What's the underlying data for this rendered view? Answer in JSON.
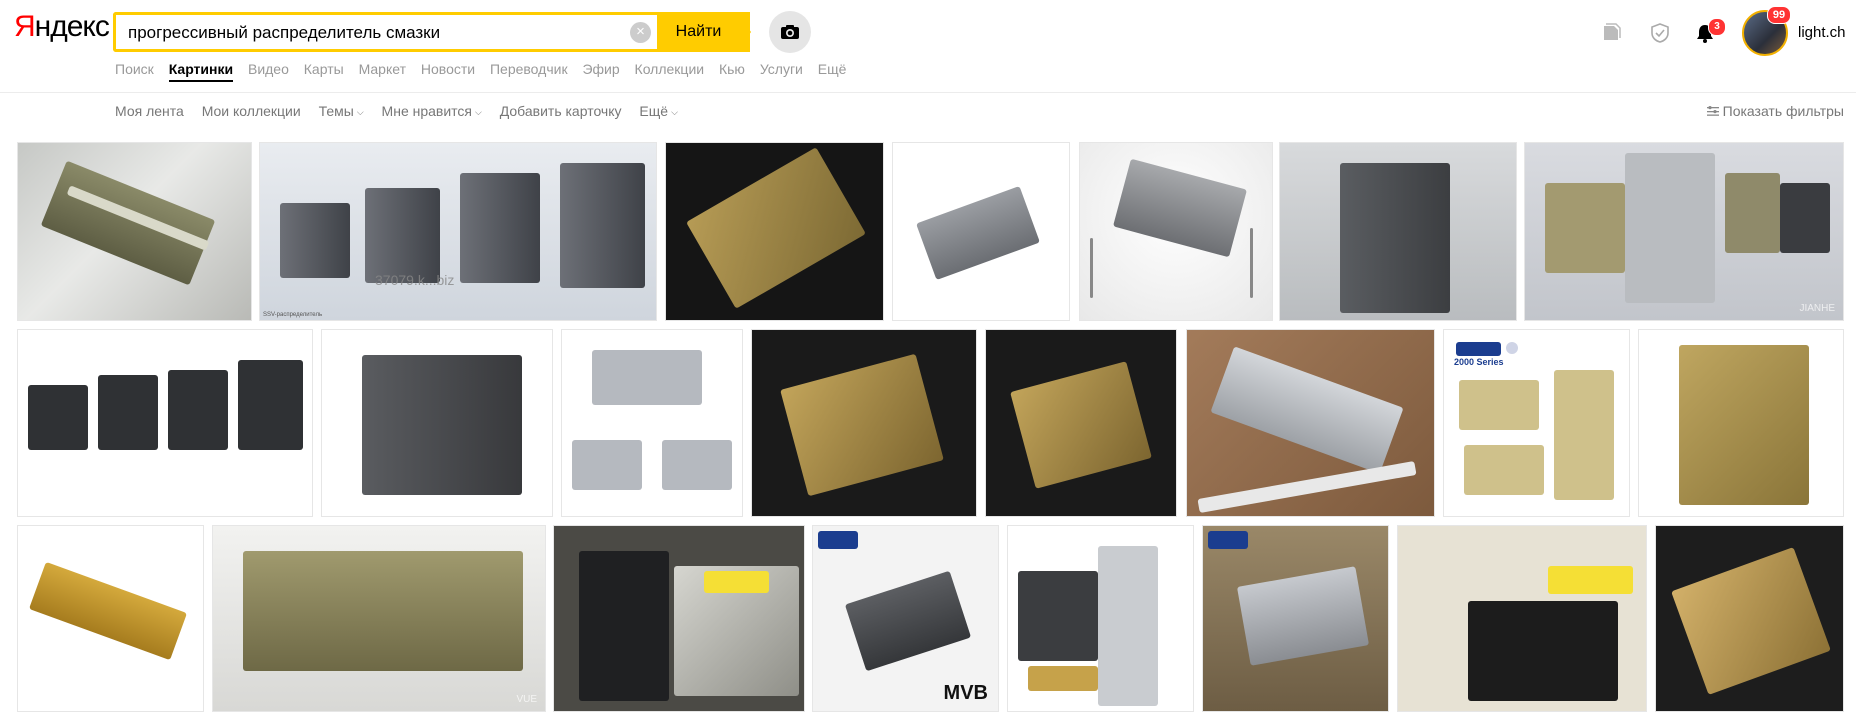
{
  "logo": {
    "first": "Я",
    "rest": "ндекс"
  },
  "search": {
    "value": "прогрессивный распределитель смазки",
    "button": "Найти"
  },
  "tabs": [
    {
      "label": "Поиск"
    },
    {
      "label": "Картинки"
    },
    {
      "label": "Видео"
    },
    {
      "label": "Карты"
    },
    {
      "label": "Маркет"
    },
    {
      "label": "Новости"
    },
    {
      "label": "Переводчик"
    },
    {
      "label": "Эфир"
    },
    {
      "label": "Коллекции"
    },
    {
      "label": "Кью"
    },
    {
      "label": "Услуги"
    },
    {
      "label": "Ещё"
    }
  ],
  "header": {
    "notifications_count": "3",
    "avatar_badge": "99",
    "username": "light.ch"
  },
  "subnav": {
    "my_feed": "Моя лента",
    "my_collections": "Мои коллекции",
    "themes": "Темы",
    "likes": "Мне нравится",
    "add_card": "Добавить карточку",
    "more": "Ещё",
    "show_filters": "Показать фильтры"
  },
  "thumb_text": {
    "ssv_caption": "SSV-распределитель",
    "site_watermark": "37079.k...biz",
    "jianhe": "JIANHE",
    "series": "2000 Series",
    "vue": "VUE",
    "mvb": "MVB"
  },
  "colors": {
    "accent": "#ffcc00",
    "badge": "#ff3333",
    "brand_red": "#ff0000"
  }
}
